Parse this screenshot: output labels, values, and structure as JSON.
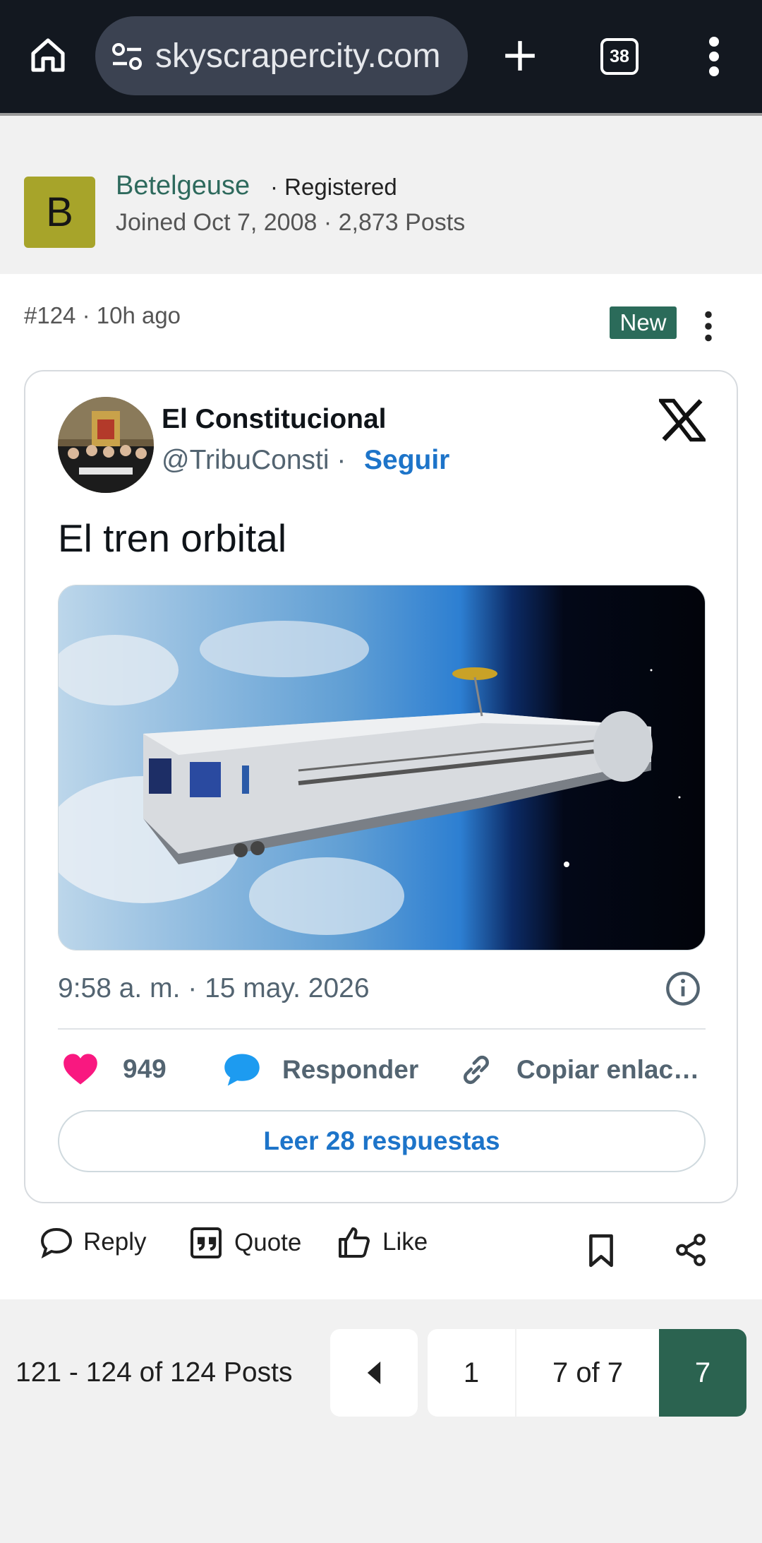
{
  "browser": {
    "url": "skyscrapercity.com",
    "tab_count": "38"
  },
  "author": {
    "avatar_letter": "B",
    "name": "Betelgeuse",
    "role": "· Registered",
    "meta": "Joined Oct 7, 2008 · 2,873 Posts"
  },
  "post": {
    "number_time": "#124 · 10h ago",
    "new_badge": "New"
  },
  "tweet": {
    "name": "El Constitucional",
    "handle": "@TribuConsti ·",
    "follow": "Seguir",
    "text": "El tren orbital",
    "timestamp": "9:58 a. m. · 15 may. 2026",
    "likes": "949",
    "reply_label": "Responder",
    "copy_label": "Copiar enlac…",
    "read_replies": "Leer 28 respuestas"
  },
  "post_actions": {
    "reply": "Reply",
    "quote": "Quote",
    "like": "Like"
  },
  "pagination": {
    "count": "121 - 124 of 124 Posts",
    "first": "1",
    "page_of": "7 of 7",
    "current": "7"
  },
  "colors": {
    "accent": "#2b6b5a",
    "link": "#1d74c9",
    "heart": "#f91880",
    "reply_bubble": "#1d9bf0"
  }
}
